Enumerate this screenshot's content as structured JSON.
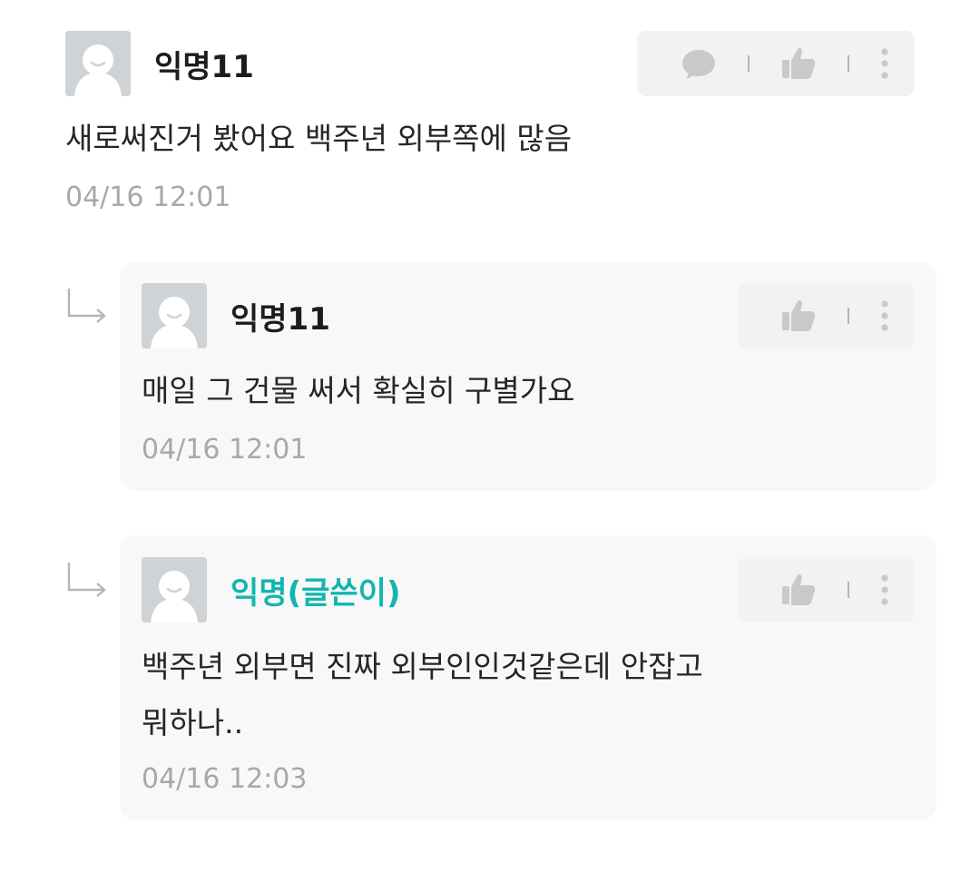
{
  "colors": {
    "author_highlight": "#12b5b0",
    "timestamp": "#a8a8a8",
    "reply_bg": "#f8f8f8",
    "action_bg": "#f2f2f2"
  },
  "comments": [
    {
      "nickname": "익명11",
      "text": "새로써진거 봤어요 백주년 외부쪽에 많음",
      "time": "04/16 12:01",
      "actions": [
        "reply-icon",
        "like-icon",
        "more-icon"
      ]
    }
  ],
  "replies": [
    {
      "nickname": "익명11",
      "text_lines": [
        "매일 그 건물 써서 확실히 구별가요"
      ],
      "time": "04/16 12:01",
      "actions": [
        "like-icon",
        "more-icon"
      ]
    },
    {
      "nickname": "익명(글쓴이)",
      "is_author": true,
      "text_lines": [
        "백주년 외부면 진짜 외부인인것같은데 안잡고",
        "뭐하나.."
      ],
      "time": "04/16 12:03",
      "actions": [
        "like-icon",
        "more-icon"
      ]
    }
  ]
}
